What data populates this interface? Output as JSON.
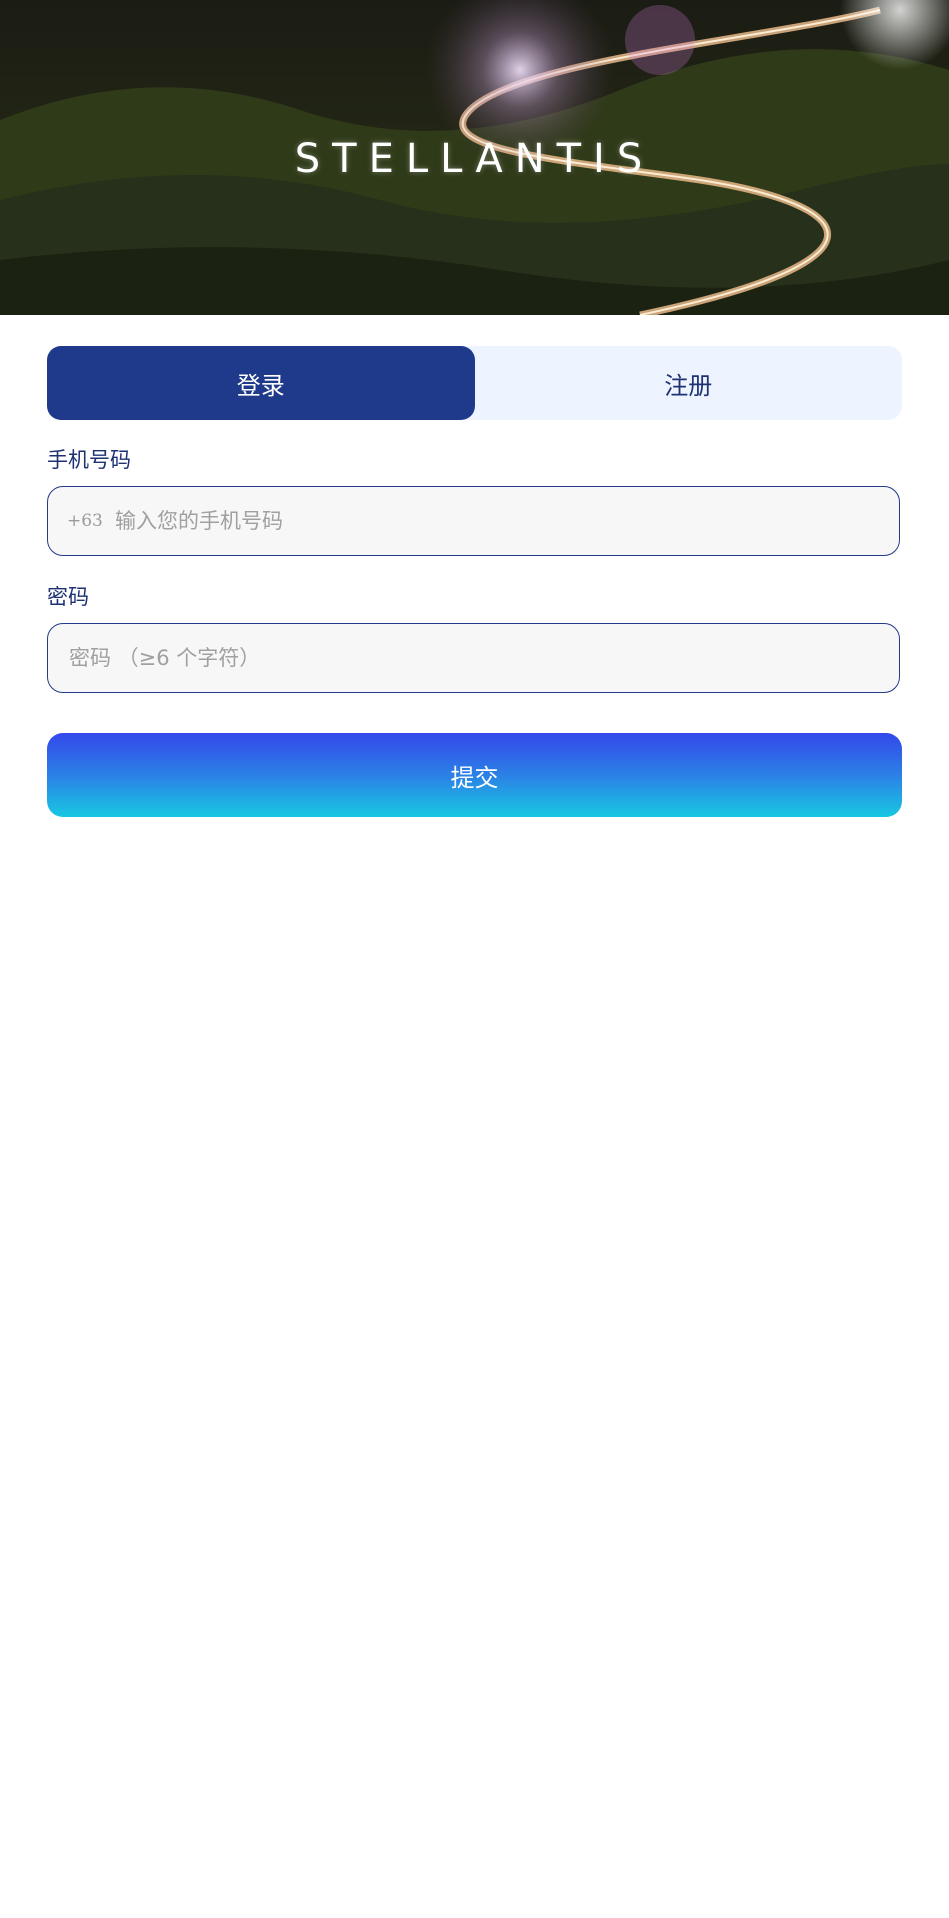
{
  "header": {
    "logo_text": "STELLANTIS"
  },
  "tabs": {
    "login_label": "登录",
    "register_label": "注册",
    "active": "login"
  },
  "form": {
    "phone_label": "手机号码",
    "phone_prefix": "+63",
    "phone_placeholder": "输入您的手机号码",
    "phone_value": "",
    "password_label": "密码",
    "password_placeholder": "密码 （≥6 个字符）",
    "password_value": "",
    "submit_label": "提交"
  },
  "colors": {
    "primary": "#1f3a8a",
    "tab_inactive_bg": "#eef4ff",
    "label_text": "#1e3273",
    "submit_gradient_top": "#3448ea",
    "submit_gradient_bottom": "#18c8e2"
  }
}
